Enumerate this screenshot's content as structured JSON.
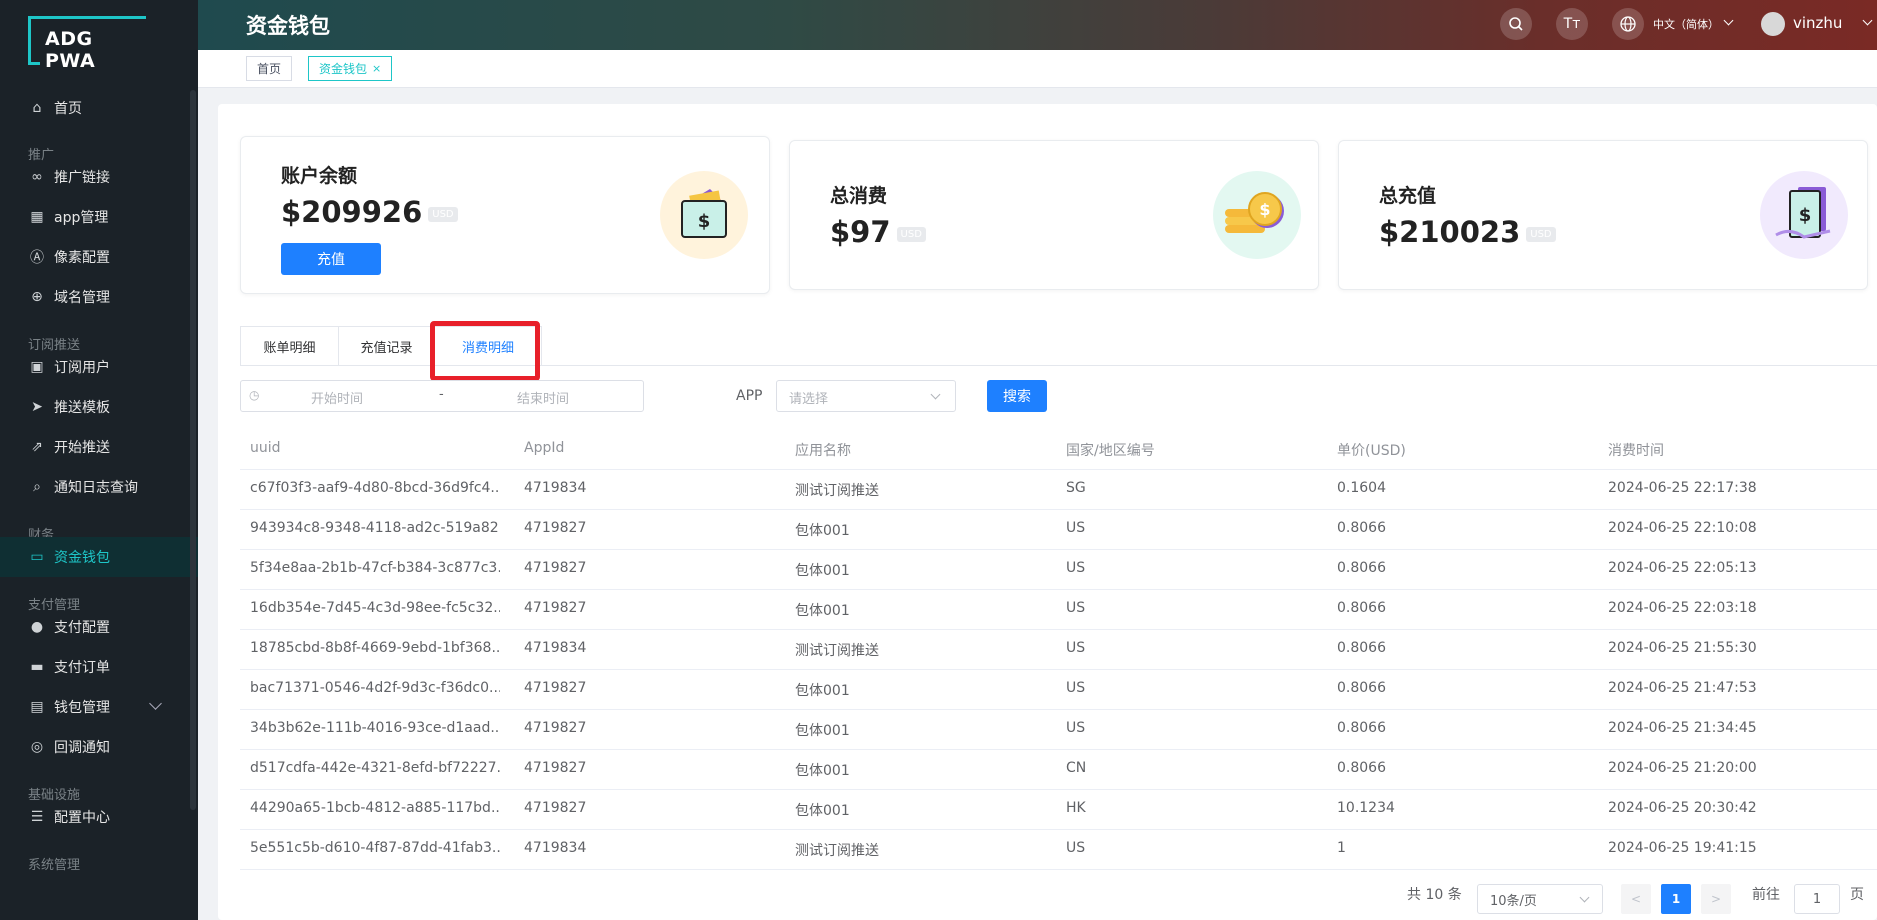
{
  "app": {
    "logo": "ADG PWA"
  },
  "sidebar": {
    "items": [
      {
        "label": "首页",
        "icon": "home-icon",
        "glyph": "⌂"
      },
      {
        "label": "推广",
        "group": true
      },
      {
        "label": "推广链接",
        "icon": "link-icon",
        "glyph": "∞"
      },
      {
        "label": "app管理",
        "icon": "grid-icon",
        "glyph": "▦"
      },
      {
        "label": "像素配置",
        "icon": "ad-icon",
        "glyph": "Ⓐ"
      },
      {
        "label": "域名管理",
        "icon": "globe-icon",
        "glyph": "⊕"
      },
      {
        "label": "订阅推送",
        "group": true
      },
      {
        "label": "订阅用户",
        "icon": "subscriber-icon",
        "glyph": "▣"
      },
      {
        "label": "推送模板",
        "icon": "send-icon",
        "glyph": "➤"
      },
      {
        "label": "开始推送",
        "icon": "external-icon",
        "glyph": "⇗"
      },
      {
        "label": "通知日志查询",
        "icon": "search-log-icon",
        "glyph": "⌕"
      },
      {
        "label": "财务",
        "group": true
      },
      {
        "label": "资金钱包",
        "icon": "wallet-icon",
        "glyph": "▭"
      },
      {
        "label": "支付管理",
        "group": true
      },
      {
        "label": "支付配置",
        "icon": "apple-icon",
        "glyph": "●"
      },
      {
        "label": "支付订单",
        "icon": "card-icon",
        "glyph": "▬"
      },
      {
        "label": "钱包管理",
        "icon": "wallet-manage-icon",
        "glyph": "▤"
      },
      {
        "label": "回调通知",
        "icon": "bell-icon",
        "glyph": "◎"
      },
      {
        "label": "基础设施",
        "group": true
      },
      {
        "label": "配置中心",
        "icon": "sliders-icon",
        "glyph": "☰"
      },
      {
        "label": "系统管理",
        "group": true
      }
    ]
  },
  "header": {
    "title": "资金钱包",
    "font_btn": "Tт",
    "language": "中文（简体）",
    "username": "vinzhu"
  },
  "tags": {
    "home": "首页",
    "current": "资金钱包",
    "close": "×"
  },
  "cards": {
    "balance": {
      "label": "账户余额",
      "amount": "$209926",
      "unit": "USD",
      "button": "充值"
    },
    "spent": {
      "label": "总消费",
      "amount": "$97",
      "unit": "USD"
    },
    "recharged": {
      "label": "总充值",
      "amount": "$210023",
      "unit": "USD"
    }
  },
  "tabs": [
    "账单明细",
    "充值记录",
    "消费明细"
  ],
  "filters": {
    "start_placeholder": "开始时间",
    "separator": "-",
    "end_placeholder": "结束时间",
    "app_label": "APP",
    "app_placeholder": "请选择",
    "search_button": "搜索"
  },
  "table": {
    "headers": [
      "uuid",
      "AppId",
      "应用名称",
      "国家/地区编号",
      "单价(USD)",
      "消费时间"
    ],
    "rows": [
      [
        "c67f03f3-aaf9-4d80-8bcd-36d9fc4...",
        "4719834",
        "测试订阅推送",
        "SG",
        "0.1604",
        "2024-06-25 22:17:38"
      ],
      [
        "943934c8-9348-4118-ad2c-519a82...",
        "4719827",
        "包体001",
        "US",
        "0.8066",
        "2024-06-25 22:10:08"
      ],
      [
        "5f34e8aa-2b1b-47cf-b384-3c877c3...",
        "4719827",
        "包体001",
        "US",
        "0.8066",
        "2024-06-25 22:05:13"
      ],
      [
        "16db354e-7d45-4c3d-98ee-fc5c32...",
        "4719827",
        "包体001",
        "US",
        "0.8066",
        "2024-06-25 22:03:18"
      ],
      [
        "18785cbd-8b8f-4669-9ebd-1bf368...",
        "4719834",
        "测试订阅推送",
        "US",
        "0.8066",
        "2024-06-25 21:55:30"
      ],
      [
        "bac71371-0546-4d2f-9d3c-f36dc0...",
        "4719827",
        "包体001",
        "US",
        "0.8066",
        "2024-06-25 21:47:53"
      ],
      [
        "34b3b62e-111b-4016-93ce-d1aad...",
        "4719827",
        "包体001",
        "US",
        "0.8066",
        "2024-06-25 21:34:45"
      ],
      [
        "d517cdfa-442e-4321-8efd-bf72227...",
        "4719827",
        "包体001",
        "CN",
        "0.8066",
        "2024-06-25 21:20:00"
      ],
      [
        "44290a65-1bcb-4812-a885-117bd...",
        "4719827",
        "包体001",
        "HK",
        "10.1234",
        "2024-06-25 20:30:42"
      ],
      [
        "5e551c5b-d610-4f87-87dd-41fab3...",
        "4719834",
        "测试订阅推送",
        "US",
        "1",
        "2024-06-25 19:41:15"
      ]
    ]
  },
  "pagination": {
    "total": "共 10 条",
    "page_size": "10条/页",
    "current_page": "1",
    "goto_label": "前往",
    "goto_value": "1",
    "page_suffix": "页"
  },
  "colors": {
    "accent": "#1ec6c8",
    "primary": "#1e80ff",
    "highlight": "#e8202a"
  }
}
